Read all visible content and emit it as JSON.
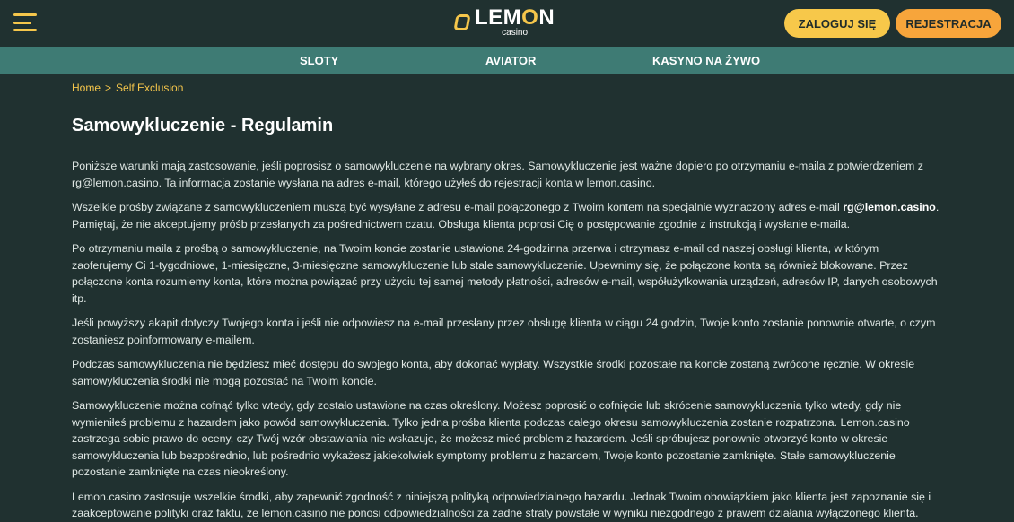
{
  "header": {
    "logo_word_1": "LEM",
    "logo_word_o": "O",
    "logo_word_2": "N",
    "logo_sub": "casino",
    "login_label": "ZALOGUJ SIĘ",
    "register_label": "REJESTRACJA"
  },
  "nav": {
    "items": [
      "SLOTY",
      "AVIATOR",
      "KASYNO NA ŻYWO"
    ]
  },
  "breadcrumb": {
    "home": "Home",
    "separator": ">",
    "current": "Self Exclusion"
  },
  "page": {
    "title": "Samowykluczenie - Regulamin",
    "paragraphs": [
      "Poniższe warunki mają zastosowanie, jeśli poprosisz o samowykluczenie na wybrany okres. Samowykluczenie jest ważne dopiero po otrzymaniu e-maila z potwierdzeniem z rg@lemon.casino. Ta informacja zostanie wysłana na adres e-mail, którego użyłeś do rejestracji konta w lemon.casino.",
      "Pamiętaj, że nie akceptujemy próśb przesłanych za pośrednictwem czatu. Obsługa klienta poprosi Cię o postępowanie zgodnie z instrukcją i wysłanie e-maila.",
      "Po otrzymaniu maila z prośbą o samowykluczenie, na Twoim koncie zostanie ustawiona 24-godzinna przerwa i otrzymasz e-mail od naszej obsługi klienta, w którym zaoferujemy Ci 1-tygodniowe, 1-miesięczne, 3-miesięczne samowykluczenie lub stałe samowykluczenie. Upewnimy się, że połączone konta są również blokowane. Przez połączone konta rozumiemy konta, które można powiązać przy użyciu tej samej metody płatności, adresów e-mail, współużytkowania urządzeń, adresów IP, danych osobowych itp.",
      "Jeśli powyższy akapit dotyczy Twojego konta i jeśli nie odpowiesz na e-mail przesłany przez obsługę klienta w ciągu 24 godzin, Twoje konto zostanie ponownie otwarte, o czym zostaniesz poinformowany e-mailem.",
      "Podczas samowykluczenia nie będziesz mieć dostępu do swojego konta, aby dokonać wypłaty. Wszystkie środki pozostałe na koncie zostaną zwrócone ręcznie. W okresie samowykluczenia środki nie mogą pozostać na Twoim koncie.",
      "Samowykluczenie można cofnąć tylko wtedy, gdy zostało ustawione na czas określony. Możesz poprosić o cofnięcie lub skrócenie samowykluczenia tylko wtedy, gdy nie wymieniłeś problemu z hazardem jako powód samowykluczenia. Tylko jedna prośba klienta podczas całego okresu samowykluczenia zostanie rozpatrzona. Lemon.casino zastrzega sobie prawo do oceny, czy Twój wzór obstawiania nie wskazuje, że możesz mieć problem z hazardem. Jeśli spróbujesz ponownie otworzyć konto w okresie samowykluczenia lub bezpośrednio, lub pośrednio wykażesz jakiekolwiek symptomy problemu z hazardem, Twoje konto pozostanie zamknięte. Stałe samowykluczenie pozostanie zamknięte na czas nieokreślony.",
      "Lemon.casino zastosuje wszelkie środki, aby zapewnić zgodność z niniejszą polityką odpowiedzialnego hazardu. Jednak Twoim obowiązkiem jako klienta jest zapoznanie się i zaakceptowanie polityki oraz faktu, że lemon.casino nie ponosi odpowiedzialności za żadne straty powstałe w wyniku niezgodnego z prawem działania wyłączonego klienta."
    ],
    "paragraph_2_prefix": "Wszelkie prośby związane z samowykluczeniem muszą być wysyłane z adresu e-mail połączonego z Twoim kontem na specjalnie wyznaczony adres e-mail ",
    "paragraph_2_email": "rg@lemon.casino",
    "paragraph_2_suffix": "."
  },
  "colors": {
    "background": "#203130",
    "nav_bar": "#3e7b74",
    "accent_yellow": "#f5c64b",
    "accent_orange": "#f7a53b"
  }
}
